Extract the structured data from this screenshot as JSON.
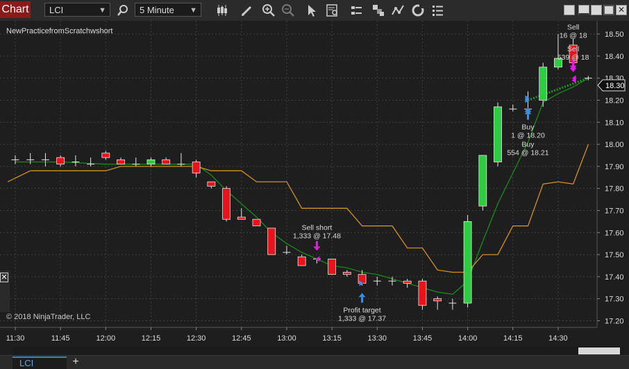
{
  "toolbar": {
    "chart_tab": "Chart",
    "instrument": "LCI",
    "interval": "5 Minute"
  },
  "bottom": {
    "tab_label": "LCI",
    "add_label": "+"
  },
  "side": {
    "close_label": "✕"
  },
  "colors": {
    "up": "#2ecc40",
    "down": "#e8141c",
    "ema_fast": "#1a8a1a",
    "ema_slow": "#d4901e",
    "marker_buy": "#3a8ee6",
    "marker_sell": "#e020e0",
    "background": "#1e1e1e",
    "grid": "#3e3e3e"
  },
  "chart_data": {
    "type": "candlestick",
    "title": "NewPracticefromScratchwshort",
    "copyright": "© 2018 NinjaTrader, LLC",
    "ylim": [
      17.17,
      18.56
    ],
    "y_ticks": [
      "17.20",
      "17.30",
      "17.40",
      "17.50",
      "17.60",
      "17.70",
      "17.80",
      "17.90",
      "18.00",
      "18.10",
      "18.20",
      "18.30",
      "18.40",
      "18.50"
    ],
    "x_ticks": [
      {
        "label": "11:30",
        "x": 0
      },
      {
        "label": "11:45",
        "x": 3
      },
      {
        "label": "12:00",
        "x": 6
      },
      {
        "label": "12:15",
        "x": 9
      },
      {
        "label": "12:30",
        "x": 12
      },
      {
        "label": "12:45",
        "x": 15
      },
      {
        "label": "13:00",
        "x": 18
      },
      {
        "label": "13:15",
        "x": 21
      },
      {
        "label": "13:30",
        "x": 24
      },
      {
        "label": "13:45",
        "x": 27
      },
      {
        "label": "14:00",
        "x": 30
      },
      {
        "label": "14:15",
        "x": 33
      },
      {
        "label": "14:30",
        "x": 36
      }
    ],
    "current_price": "18.30",
    "candles": [
      {
        "x": 0,
        "o": 17.93,
        "h": 17.95,
        "l": 17.91,
        "c": 17.93
      },
      {
        "x": 1,
        "o": 17.93,
        "h": 17.96,
        "l": 17.91,
        "c": 17.93
      },
      {
        "x": 2,
        "o": 17.93,
        "h": 17.96,
        "l": 17.9,
        "c": 17.93
      },
      {
        "x": 3,
        "o": 17.94,
        "h": 17.95,
        "l": 17.9,
        "c": 17.91
      },
      {
        "x": 4,
        "o": 17.92,
        "h": 17.95,
        "l": 17.9,
        "c": 17.92
      },
      {
        "x": 5,
        "o": 17.91,
        "h": 17.94,
        "l": 17.9,
        "c": 17.91
      },
      {
        "x": 6,
        "o": 17.96,
        "h": 17.97,
        "l": 17.93,
        "c": 17.94
      },
      {
        "x": 7,
        "o": 17.93,
        "h": 17.94,
        "l": 17.91,
        "c": 17.91
      },
      {
        "x": 8,
        "o": 17.91,
        "h": 17.94,
        "l": 17.9,
        "c": 17.91
      },
      {
        "x": 9,
        "o": 17.91,
        "h": 17.94,
        "l": 17.9,
        "c": 17.93
      },
      {
        "x": 10,
        "o": 17.93,
        "h": 17.94,
        "l": 17.91,
        "c": 17.91
      },
      {
        "x": 11,
        "o": 17.91,
        "h": 17.96,
        "l": 17.9,
        "c": 17.91
      },
      {
        "x": 12,
        "o": 17.92,
        "h": 17.93,
        "l": 17.85,
        "c": 17.87
      },
      {
        "x": 13,
        "o": 17.83,
        "h": 17.83,
        "l": 17.8,
        "c": 17.81
      },
      {
        "x": 14,
        "o": 17.8,
        "h": 17.81,
        "l": 17.65,
        "c": 17.66
      },
      {
        "x": 15,
        "o": 17.67,
        "h": 17.71,
        "l": 17.66,
        "c": 17.66
      },
      {
        "x": 16,
        "o": 17.66,
        "h": 17.66,
        "l": 17.63,
        "c": 17.63
      },
      {
        "x": 17,
        "o": 17.62,
        "h": 17.62,
        "l": 17.5,
        "c": 17.5
      },
      {
        "x": 18,
        "o": 17.51,
        "h": 17.54,
        "l": 17.5,
        "c": 17.51
      },
      {
        "x": 19,
        "o": 17.49,
        "h": 17.5,
        "l": 17.45,
        "c": 17.45
      },
      {
        "x": 20,
        "o": 17.48,
        "h": 17.48,
        "l": 17.46,
        "c": 17.48
      },
      {
        "x": 21,
        "o": 17.48,
        "h": 17.48,
        "l": 17.41,
        "c": 17.41
      },
      {
        "x": 22,
        "o": 17.42,
        "h": 17.43,
        "l": 17.4,
        "c": 17.41
      },
      {
        "x": 23,
        "o": 17.41,
        "h": 17.43,
        "l": 17.36,
        "c": 17.37
      },
      {
        "x": 24,
        "o": 17.38,
        "h": 17.4,
        "l": 17.36,
        "c": 17.38
      },
      {
        "x": 25,
        "o": 17.38,
        "h": 17.4,
        "l": 17.36,
        "c": 17.38
      },
      {
        "x": 26,
        "o": 17.38,
        "h": 17.39,
        "l": 17.35,
        "c": 17.37
      },
      {
        "x": 27,
        "o": 17.38,
        "h": 17.39,
        "l": 17.25,
        "c": 17.27
      },
      {
        "x": 28,
        "o": 17.3,
        "h": 17.31,
        "l": 17.25,
        "c": 17.29
      },
      {
        "x": 29,
        "o": 17.28,
        "h": 17.3,
        "l": 17.25,
        "c": 17.28
      },
      {
        "x": 30,
        "o": 17.28,
        "h": 17.68,
        "l": 17.26,
        "c": 17.65
      },
      {
        "x": 31,
        "o": 17.72,
        "h": 17.95,
        "l": 17.7,
        "c": 17.95
      },
      {
        "x": 32,
        "o": 17.92,
        "h": 18.19,
        "l": 17.9,
        "c": 18.17
      },
      {
        "x": 33,
        "o": 18.16,
        "h": 18.18,
        "l": 18.15,
        "c": 18.16
      },
      {
        "x": 34,
        "o": 18.16,
        "h": 18.24,
        "l": 18.15,
        "c": 18.16
      },
      {
        "x": 35,
        "o": 18.2,
        "h": 18.37,
        "l": 18.17,
        "c": 18.35
      },
      {
        "x": 36,
        "o": 18.35,
        "h": 18.5,
        "l": 18.34,
        "c": 18.39
      },
      {
        "x": 37,
        "o": 18.45,
        "h": 18.48,
        "l": 18.36,
        "c": 18.37
      },
      {
        "x": 38,
        "o": 18.3,
        "h": 18.31,
        "l": 18.29,
        "c": 18.3
      }
    ],
    "series": [
      {
        "name": "",
        "color_key": "ema_fast",
        "values": [
          [
            0,
            17.92
          ],
          [
            3,
            17.92
          ],
          [
            6,
            17.91
          ],
          [
            9,
            17.91
          ],
          [
            12,
            17.91
          ],
          [
            13,
            17.86
          ],
          [
            14,
            17.79
          ],
          [
            15,
            17.73
          ],
          [
            16,
            17.67
          ],
          [
            17,
            17.6
          ],
          [
            18,
            17.55
          ],
          [
            19,
            17.51
          ],
          [
            20,
            17.48
          ],
          [
            21,
            17.45
          ],
          [
            22,
            17.44
          ],
          [
            23,
            17.42
          ],
          [
            24,
            17.41
          ],
          [
            25,
            17.39
          ],
          [
            26,
            17.37
          ],
          [
            27,
            17.35
          ],
          [
            28,
            17.33
          ],
          [
            29,
            17.32
          ],
          [
            30,
            17.38
          ],
          [
            31,
            17.56
          ],
          [
            32,
            17.73
          ],
          [
            33,
            17.87
          ],
          [
            34,
            18.01
          ],
          [
            35,
            18.19
          ],
          [
            36,
            18.23
          ],
          [
            37,
            18.26
          ],
          [
            38,
            18.3
          ]
        ]
      },
      {
        "name": "",
        "color_key": "ema_slow",
        "values": [
          [
            -0.5,
            17.83
          ],
          [
            1,
            17.88
          ],
          [
            3,
            17.88
          ],
          [
            6,
            17.88
          ],
          [
            7,
            17.9
          ],
          [
            9,
            17.9
          ],
          [
            12,
            17.9
          ],
          [
            13,
            17.88
          ],
          [
            15,
            17.88
          ],
          [
            16,
            17.83
          ],
          [
            18,
            17.83
          ],
          [
            19,
            17.71
          ],
          [
            22,
            17.71
          ],
          [
            23,
            17.63
          ],
          [
            24,
            17.63
          ],
          [
            25,
            17.63
          ],
          [
            26,
            17.53
          ],
          [
            27,
            17.53
          ],
          [
            28,
            17.43
          ],
          [
            29,
            17.42
          ],
          [
            30,
            17.42
          ],
          [
            31,
            17.5
          ],
          [
            32,
            17.5
          ],
          [
            33,
            17.63
          ],
          [
            34,
            17.63
          ],
          [
            35,
            17.82
          ],
          [
            36,
            17.83
          ],
          [
            37,
            17.82
          ],
          [
            38,
            18.0
          ]
        ]
      }
    ],
    "markers": [
      {
        "type": "sell",
        "x": 20,
        "price": 17.48,
        "label1": "Sell short",
        "label2": "1,333 @ 17.48"
      },
      {
        "type": "buy",
        "x": 23,
        "price": 17.37,
        "label1": "Profit target",
        "label2": "1,333 @ 17.37"
      },
      {
        "type": "buy",
        "x": 34,
        "price": 18.2,
        "label1": "Buy",
        "label2": "1 @ 18.20"
      },
      {
        "type": "buy",
        "x": 34,
        "price": 18.21,
        "label1": "Buy",
        "label2": "554 @ 18.21"
      },
      {
        "type": "sell",
        "x": 37,
        "price": 18.3,
        "label1": "Sell",
        "label2": "16 @ 18"
      },
      {
        "type": "sell",
        "x": 37,
        "price": 18.29,
        "label1": "Sell",
        "label2": "539 @ 18"
      }
    ],
    "trade_line": {
      "from": [
        34,
        18.2
      ],
      "to": [
        38,
        18.3
      ]
    }
  }
}
